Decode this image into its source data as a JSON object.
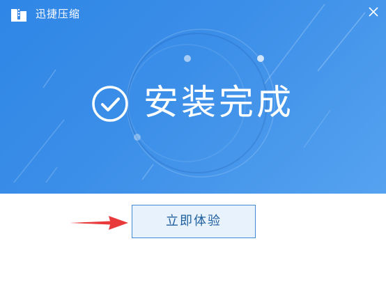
{
  "window": {
    "title": "迅捷压缩",
    "logo_icon": "app-logo-icon",
    "close_icon": "close-icon"
  },
  "banner": {
    "status_icon": "check-circle-icon",
    "status_text": "安装完成",
    "background_color": "#3c8fe8"
  },
  "action": {
    "button_label": "立即体验",
    "pointer_icon": "red-arrow-icon",
    "pointer_color": "#e83a3a"
  }
}
